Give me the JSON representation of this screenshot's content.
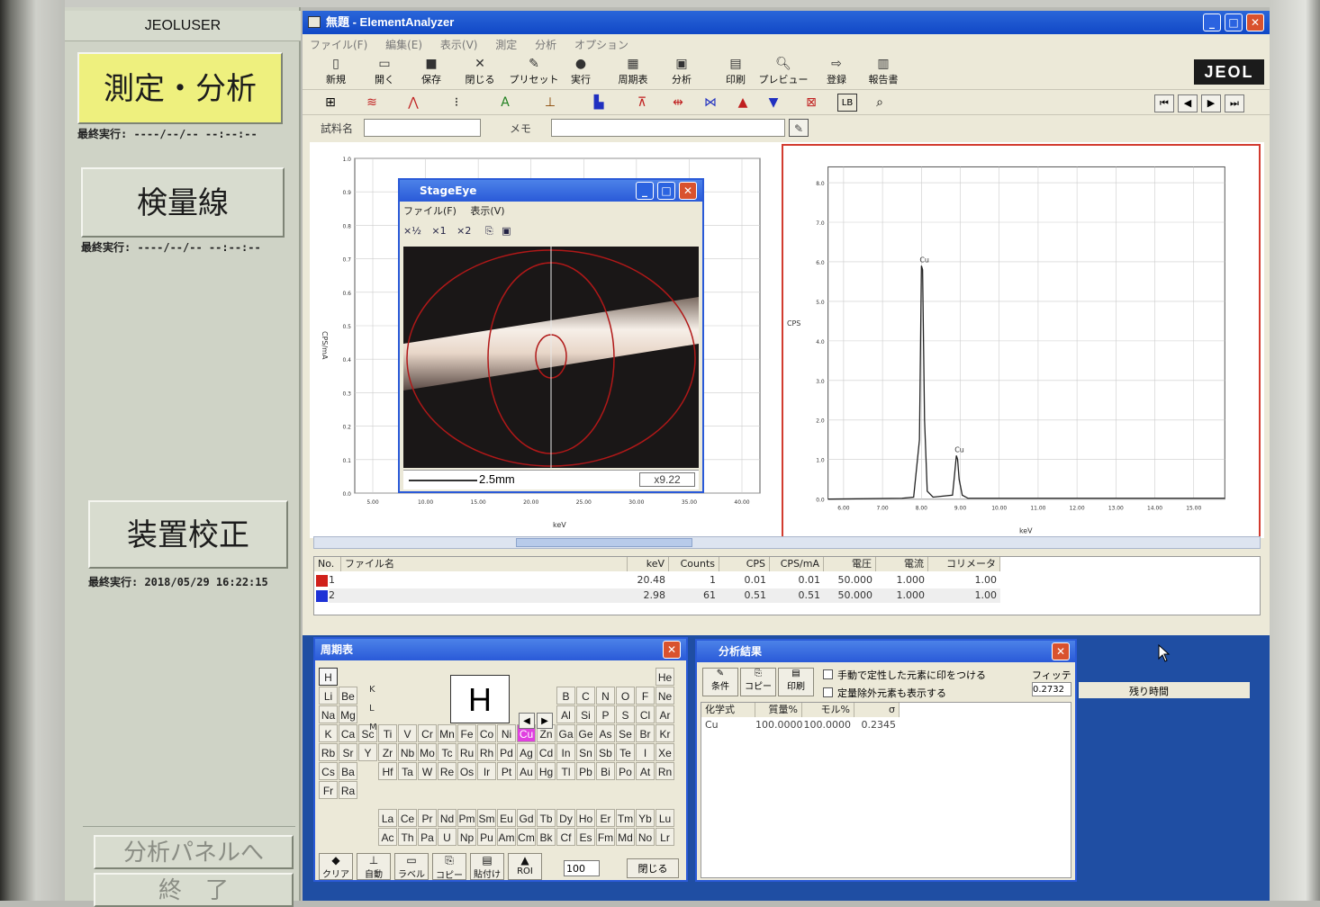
{
  "left_panel": {
    "user": "JEOLUSER",
    "measure_button": "測定・分析",
    "measure_lastrun": "最終実行: ----/--/-- --:--:--",
    "calib_curve_button": "検量線",
    "calib_curve_lastrun": "最終実行: ----/--/-- --:--:--",
    "device_calib_button": "装置校正",
    "device_calib_lastrun": "最終実行: 2018/05/29 16:22:15",
    "analysis_panel_button": "分析パネルへ",
    "exit_button": "終　了"
  },
  "window": {
    "title": "無題 - ElementAnalyzer",
    "menu": [
      "ファイル(F)",
      "編集(E)",
      "表示(V)",
      "測定",
      "分析",
      "オプション"
    ],
    "toolbar": [
      "新規",
      "開く",
      "保存",
      "閉じる",
      "プリセット",
      "実行",
      "周期表",
      "分析",
      "印刷",
      "プレビュー",
      "登録",
      "報告書"
    ],
    "brand": "JEOL",
    "sample_label": "試料名",
    "memo_label": "メモ",
    "sample_value": "",
    "memo_value": ""
  },
  "stage_eye": {
    "title": "StageEye",
    "menu": [
      "ファイル(F)",
      "表示(V)"
    ],
    "zoom_buttons": [
      "×½",
      "×1",
      "×2"
    ],
    "scale_label": "2.5mm",
    "magnification": "x9.22"
  },
  "spectrum_left": {
    "ylabel": "CPS/mA",
    "xlabel": "keV",
    "yticks": [
      "0.0",
      "0.1",
      "0.2",
      "0.3",
      "0.4",
      "0.5",
      "0.6",
      "0.7",
      "0.8",
      "0.9",
      "1.0"
    ],
    "xticks": [
      "5.00",
      "10.00",
      "15.00",
      "20.00",
      "25.00",
      "30.00",
      "35.00",
      "40.00"
    ]
  },
  "spectrum_right": {
    "ylabel": "CPS",
    "xlabel": "keV",
    "yticks": [
      "0.0",
      "1.0",
      "2.0",
      "3.0",
      "4.0",
      "5.0",
      "6.0",
      "7.0",
      "8.0"
    ],
    "xticks": [
      "6.00",
      "7.00",
      "8.00",
      "9.00",
      "10.00",
      "11.00",
      "12.00",
      "13.00",
      "14.00",
      "15.00"
    ],
    "peak_labels": [
      "Cu",
      "Cu"
    ]
  },
  "chart_data": {
    "type": "line",
    "xlabel": "keV",
    "ylabel": "CPS",
    "xlim": [
      5.6,
      15.8
    ],
    "ylim": [
      0,
      8.4
    ],
    "series": [
      {
        "x": [
          5.6,
          7.5,
          7.8,
          7.95,
          8.0,
          8.03,
          8.08,
          8.15,
          8.3,
          8.8,
          8.85,
          8.9,
          8.93,
          8.97,
          9.05,
          9.2,
          10.0,
          12.0,
          15.8
        ],
        "values": [
          0.0,
          0.02,
          0.05,
          1.5,
          5.9,
          5.8,
          2.0,
          0.2,
          0.05,
          0.1,
          0.6,
          1.1,
          1.0,
          0.5,
          0.1,
          0.02,
          0.02,
          0.02,
          0.02
        ]
      }
    ]
  },
  "results_table": {
    "headers": [
      "No.",
      "ファイル名",
      "keV",
      "Counts",
      "CPS",
      "CPS/mA",
      "電圧",
      "電流",
      "コリメータ"
    ],
    "rows": [
      {
        "no": "1",
        "file": "",
        "kev": "20.48",
        "counts": "1",
        "cps": "0.01",
        "cpsma": "0.01",
        "voltage": "50.000",
        "current": "1.000",
        "collimator": "1.00",
        "color": "#d0201a"
      },
      {
        "no": "2",
        "file": "",
        "kev": "2.98",
        "counts": "61",
        "cps": "0.51",
        "cpsma": "0.51",
        "voltage": "50.000",
        "current": "1.000",
        "collimator": "1.00",
        "color": "#1e32d6"
      }
    ]
  },
  "periodic": {
    "title": "周期表",
    "selected_symbol": "H",
    "shell_labels": [
      "K",
      "L",
      "M"
    ],
    "rows": [
      [
        "H",
        "",
        "",
        "",
        "",
        "",
        "",
        "",
        "",
        "",
        "",
        "",
        "",
        "",
        "",
        "",
        "",
        "He"
      ],
      [
        "Li",
        "Be",
        "",
        "",
        "",
        "",
        "",
        "",
        "",
        "",
        "",
        "",
        "B",
        "C",
        "N",
        "O",
        "F",
        "Ne"
      ],
      [
        "Na",
        "Mg",
        "",
        "",
        "",
        "",
        "",
        "",
        "",
        "",
        "",
        "",
        "Al",
        "Si",
        "P",
        "S",
        "Cl",
        "Ar"
      ],
      [
        "K",
        "Ca",
        "Sc",
        "Ti",
        "V",
        "Cr",
        "Mn",
        "Fe",
        "Co",
        "Ni",
        "Cu",
        "Zn",
        "Ga",
        "Ge",
        "As",
        "Se",
        "Br",
        "Kr"
      ],
      [
        "Rb",
        "Sr",
        "Y",
        "Zr",
        "Nb",
        "Mo",
        "Tc",
        "Ru",
        "Rh",
        "Pd",
        "Ag",
        "Cd",
        "In",
        "Sn",
        "Sb",
        "Te",
        "I",
        "Xe"
      ],
      [
        "Cs",
        "Ba",
        "",
        "Hf",
        "Ta",
        "W",
        "Re",
        "Os",
        "Ir",
        "Pt",
        "Au",
        "Hg",
        "Tl",
        "Pb",
        "Bi",
        "Po",
        "At",
        "Rn"
      ],
      [
        "Fr",
        "Ra",
        "",
        "",
        "",
        "",
        "",
        "",
        "",
        "",
        "",
        "",
        "",
        "",
        "",
        "",
        "",
        ""
      ]
    ],
    "lanthanides": [
      "La",
      "Ce",
      "Pr",
      "Nd",
      "Pm",
      "Sm",
      "Eu",
      "Gd",
      "Tb",
      "Dy",
      "Ho",
      "Er",
      "Tm",
      "Yb",
      "Lu"
    ],
    "actinides": [
      "Ac",
      "Th",
      "Pa",
      "U",
      "Np",
      "Pu",
      "Am",
      "Cm",
      "Bk",
      "Cf",
      "Es",
      "Fm",
      "Md",
      "No",
      "Lr"
    ],
    "highlighted": "Cu",
    "buttons": [
      "クリア",
      "自動",
      "ラベル",
      "コピー",
      "貼付け",
      "ROI"
    ],
    "roi_value": "100",
    "close_button": "閉じる"
  },
  "analysis": {
    "title": "分析結果",
    "buttons": [
      "条件",
      "コピー",
      "印刷"
    ],
    "checkbox1": "手動で定性した元素に印をつける",
    "checkbox2": "定量除外元素も表示する",
    "fitting_label": "フィッティ",
    "fitting_value": "0.2732",
    "headers": [
      "化学式",
      "質量%",
      "モル%",
      "σ"
    ],
    "rows": [
      {
        "formula": "Cu",
        "mass": "100.0000",
        "mol": "100.0000",
        "sigma": "0.2345"
      }
    ],
    "remaining_time_label": "残り時間"
  }
}
